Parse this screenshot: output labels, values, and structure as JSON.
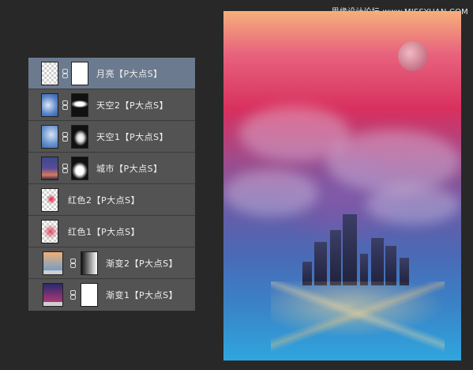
{
  "watermark": "思缘设计论坛 www.MISSYUAN.COM",
  "layers": [
    {
      "name": "月亮【P大点S】",
      "selected": true,
      "type": "moon"
    },
    {
      "name": "天空2【P大点S】",
      "selected": false,
      "type": "sky2"
    },
    {
      "name": "天空1【P大点S】",
      "selected": false,
      "type": "sky1"
    },
    {
      "name": "城市【P大点S】",
      "selected": false,
      "type": "city"
    },
    {
      "name": "红色2【P大点S】",
      "selected": false,
      "type": "red2"
    },
    {
      "name": "红色1【P大点S】",
      "selected": false,
      "type": "red1"
    },
    {
      "name": "渐变2【P大点S】",
      "selected": false,
      "type": "grad2"
    },
    {
      "name": "渐变1【P大点S】",
      "selected": false,
      "type": "grad1"
    }
  ],
  "colors": {
    "panel_bg": "#535353",
    "selected_bg": "#6b7a8e",
    "app_bg": "#282828"
  }
}
